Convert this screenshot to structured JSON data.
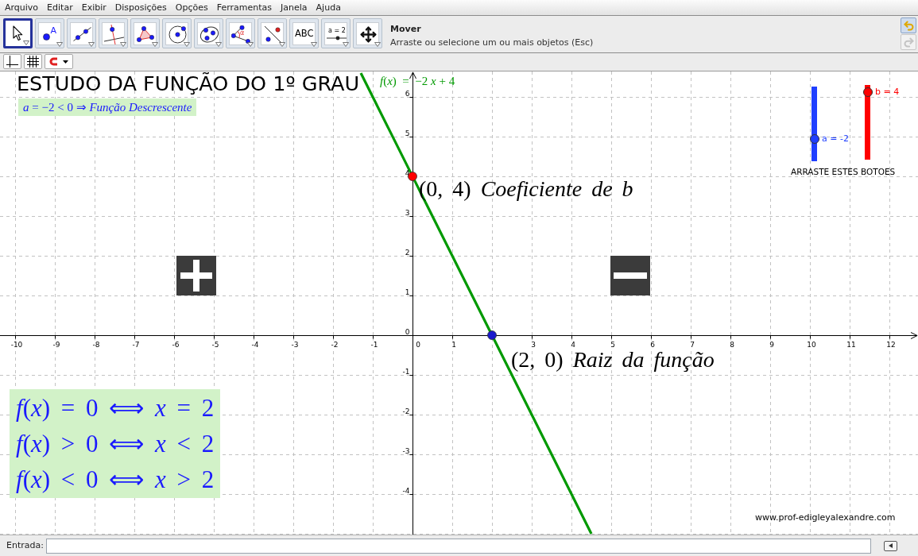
{
  "menu": [
    "Arquivo",
    "Editar",
    "Exibir",
    "Disposições",
    "Opções",
    "Ferramentas",
    "Janela",
    "Ajuda"
  ],
  "toolbar": {
    "tools": [
      {
        "kind": "move",
        "selected": true
      },
      {
        "kind": "point",
        "label": "A",
        "selected": false
      },
      {
        "kind": "line",
        "selected": false
      },
      {
        "kind": "perpendicular",
        "selected": false
      },
      {
        "kind": "polygon",
        "selected": false
      },
      {
        "kind": "circle",
        "selected": false
      },
      {
        "kind": "conic",
        "selected": false
      },
      {
        "kind": "angle",
        "label": "α",
        "selected": false
      },
      {
        "kind": "reflect",
        "selected": false
      },
      {
        "kind": "text",
        "label": "ABC",
        "selected": false
      },
      {
        "kind": "slider",
        "label": "a = 2",
        "selected": false
      },
      {
        "kind": "move-view",
        "selected": false
      }
    ],
    "tool_name": "Mover",
    "tool_help": "Arraste ou selecione um ou mais objetos (Esc)",
    "undo": {
      "disabled": false
    },
    "redo": {
      "disabled": true
    }
  },
  "graphics": {
    "title": "ESTUDO DA FUNÇÃO DO 1º GRAU",
    "slope_note": "*a* = −2 < 0 ⇒ *Função Descrescente*",
    "chart_data": {
      "type": "line",
      "grid": true,
      "x": [
        -1.3,
        4.5
      ],
      "series": [
        {
          "name": "*f*(*x*)  =  −2 *x* + 4",
          "color": "#009900",
          "values": [
            6.6,
            -5
          ]
        }
      ],
      "xlim": [
        -10.38,
        12.72
      ],
      "ylim": [
        -5.02,
        6.64
      ],
      "xticks": [
        -10,
        -9,
        -8,
        -7,
        -6,
        -5,
        -4,
        -3,
        -2,
        -1,
        0,
        1,
        3,
        4,
        5,
        6,
        7,
        8,
        9,
        10,
        11,
        12
      ],
      "yticks": [
        -4,
        -3,
        -2,
        -1,
        0,
        1,
        2,
        3,
        4,
        5,
        6
      ]
    },
    "points": [
      {
        "label": "(0, 4) *Coeficiente de b*",
        "color": "#ff0000"
      },
      {
        "label": "(2, 0) *Raiz da função*",
        "color": "#1a1acc"
      }
    ],
    "sliders": [
      {
        "label": "a = -2",
        "level": 0.3,
        "color": "#1f3fff"
      },
      {
        "label": "b = 4",
        "level": 0.9,
        "color": "#ff0000"
      }
    ],
    "slider_hint": "ARRASTE ESTES BOTOES",
    "conditions": [
      "*f*(*x*) = 0 ⟺ *x* = 2",
      "*f*(*x*) > 0 ⟺ *x* < 2",
      "*f*(*x*) < 0 ⟺ *x* > 2"
    ],
    "credit": "www.prof-edigleyalexandre.com"
  },
  "input_bar": {
    "label": "Entrada:"
  }
}
